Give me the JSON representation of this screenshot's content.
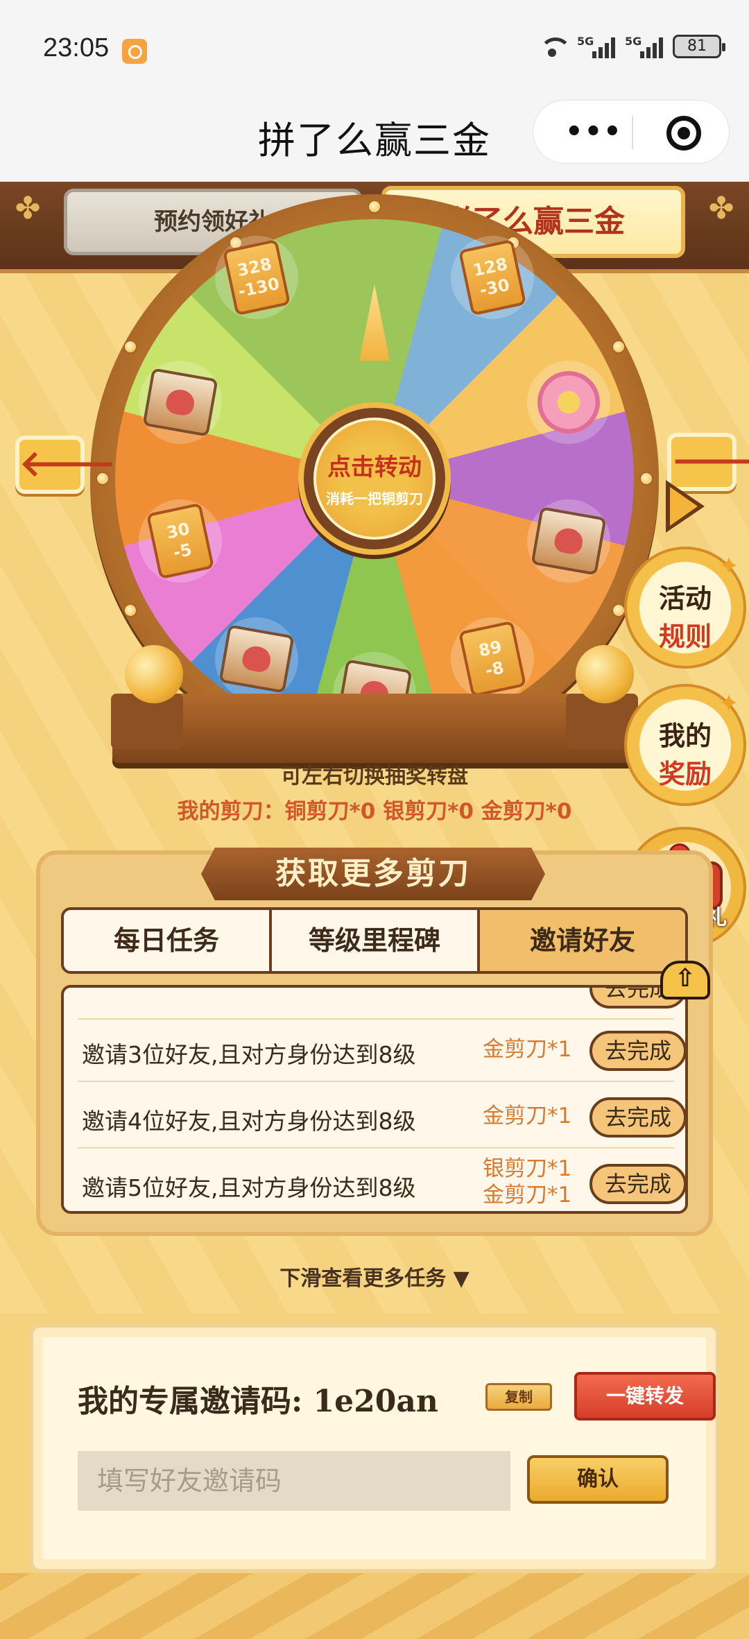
{
  "status_bar": {
    "time": "23:05",
    "network_1": "5G",
    "network_2": "5G",
    "battery": "81"
  },
  "nav": {
    "title": "拼了么赢三金",
    "more_icon": "•••"
  },
  "tabs": {
    "left": "预约领好礼",
    "right": "拼了么赢三金"
  },
  "wheel": {
    "hub_main": "点击转动",
    "hub_sub": "消耗一把铜剪刀",
    "coupons": [
      {
        "top": "328",
        "bottom": "-130"
      },
      {
        "top": "128",
        "bottom": "-30"
      },
      {
        "top": "30",
        "bottom": "-5"
      },
      {
        "top": "89",
        "bottom": "-8"
      }
    ],
    "left_arrow": "🡐",
    "right_arrow": "🡒"
  },
  "switch_hint": "可左右切换抽奖转盘",
  "my_scissors": "我的剪刀：铜剪刀*0 银剪刀*0 金剪刀*0",
  "float_buttons": {
    "rules": {
      "l1": "活动",
      "l2": "规则"
    },
    "rewards": {
      "l1": "我的",
      "l2": "奖励"
    },
    "game": {
      "caption": "体验有礼"
    }
  },
  "task_panel": {
    "banner": "获取更多剪刀",
    "tabs": [
      "每日任务",
      "等级里程碑",
      "邀请好友"
    ],
    "rows": [
      {
        "desc": "邀请3位好友,且对方身份达到8级",
        "reward_1": "金剪刀*1",
        "reward_2": "",
        "button": "去完成"
      },
      {
        "desc": "邀请4位好友,且对方身份达到8级",
        "reward_1": "金剪刀*1",
        "reward_2": "",
        "button": "去完成"
      },
      {
        "desc": "邀请5位好友,且对方身份达到8级",
        "reward_1": "银剪刀*1",
        "reward_2": "金剪刀*1",
        "button": "去完成"
      }
    ],
    "scroll_top_icon": "⇧"
  },
  "more_tasks": "下滑查看更多任务 ▼",
  "invite": {
    "label": "我的专属邀请码: 1e20an",
    "copy": "复制",
    "share": "一键转发",
    "input_placeholder": "填写好友邀请码",
    "confirm": "确认"
  }
}
